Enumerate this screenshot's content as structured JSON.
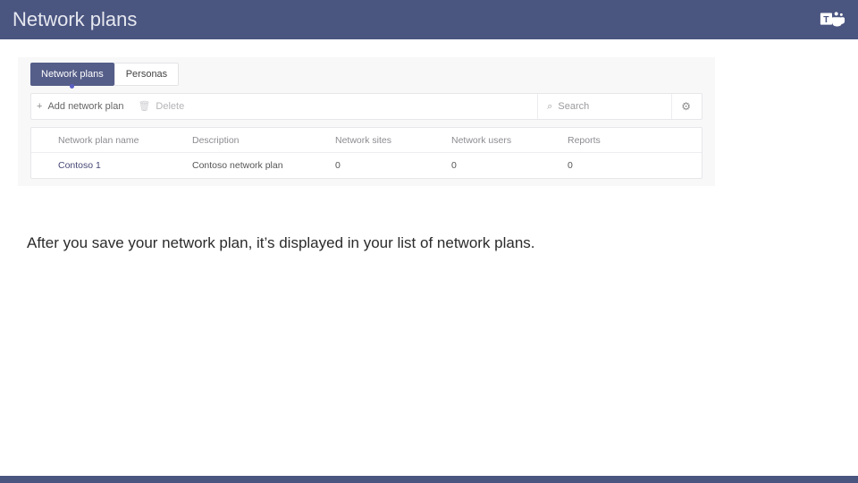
{
  "slide": {
    "title": "Network plans"
  },
  "tabs": {
    "active": "Network plans",
    "inactive": "Personas"
  },
  "toolbar": {
    "add_label": "Add network plan",
    "delete_label": "Delete",
    "search_placeholder": "Search"
  },
  "table": {
    "headers": {
      "name": "Network plan name",
      "description": "Description",
      "sites": "Network sites",
      "users": "Network users",
      "reports": "Reports"
    },
    "rows": [
      {
        "name": "Contoso 1",
        "description": "Contoso network plan",
        "sites": "0",
        "users": "0",
        "reports": "0"
      }
    ]
  },
  "caption": "After you save your network plan, it’s displayed in your list of network plans."
}
